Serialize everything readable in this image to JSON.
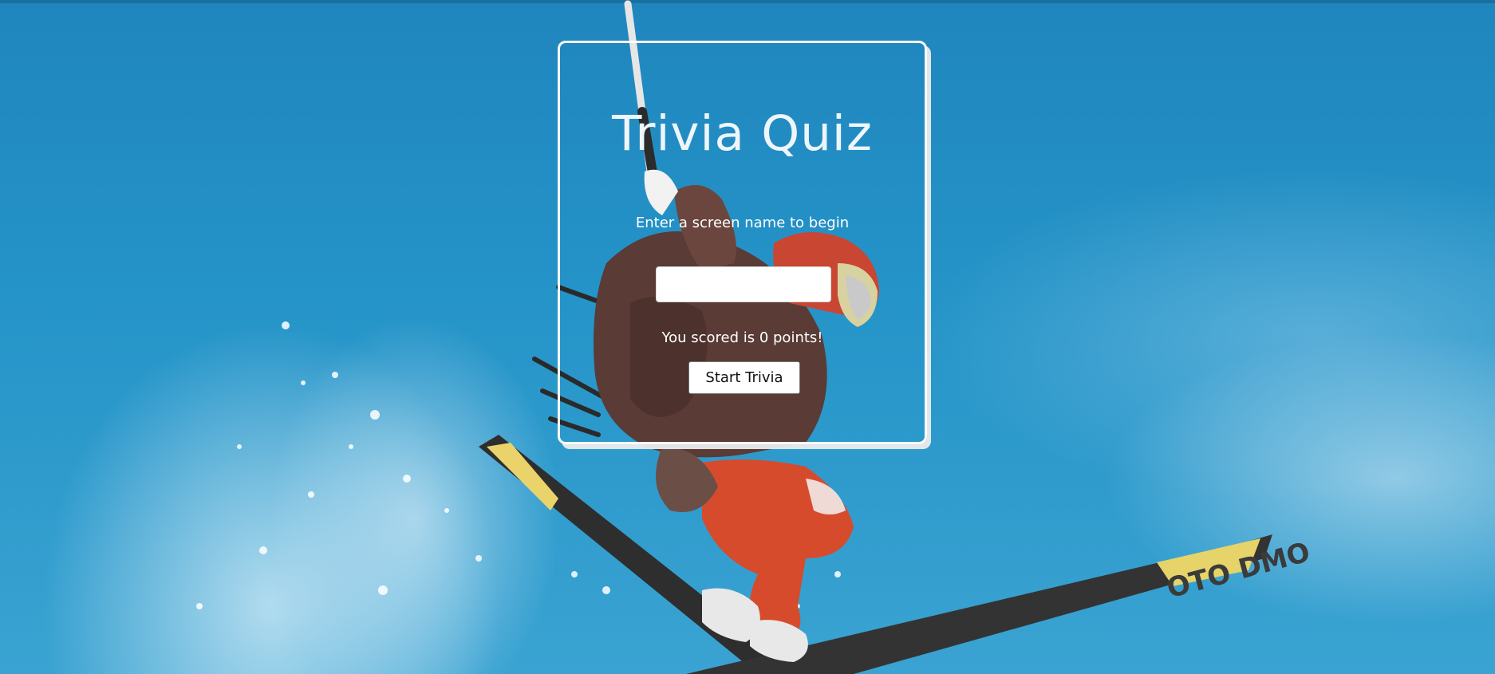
{
  "background": {
    "image": "skier-jumping-photo",
    "sky_color": "#2a8cc0",
    "ski_graphic": "OTO DMO"
  },
  "card": {
    "title": "Trivia Quiz",
    "prompt": "Enter a screen name to begin",
    "name_input": {
      "value": "",
      "placeholder": ""
    },
    "score_text": "You scored is 0 points!",
    "start_button_label": "Start Trivia"
  },
  "colors": {
    "card_border": "#ffffff",
    "title_text": "#eef6fb",
    "body_text": "#ffffff",
    "button_bg": "#ffffff"
  }
}
